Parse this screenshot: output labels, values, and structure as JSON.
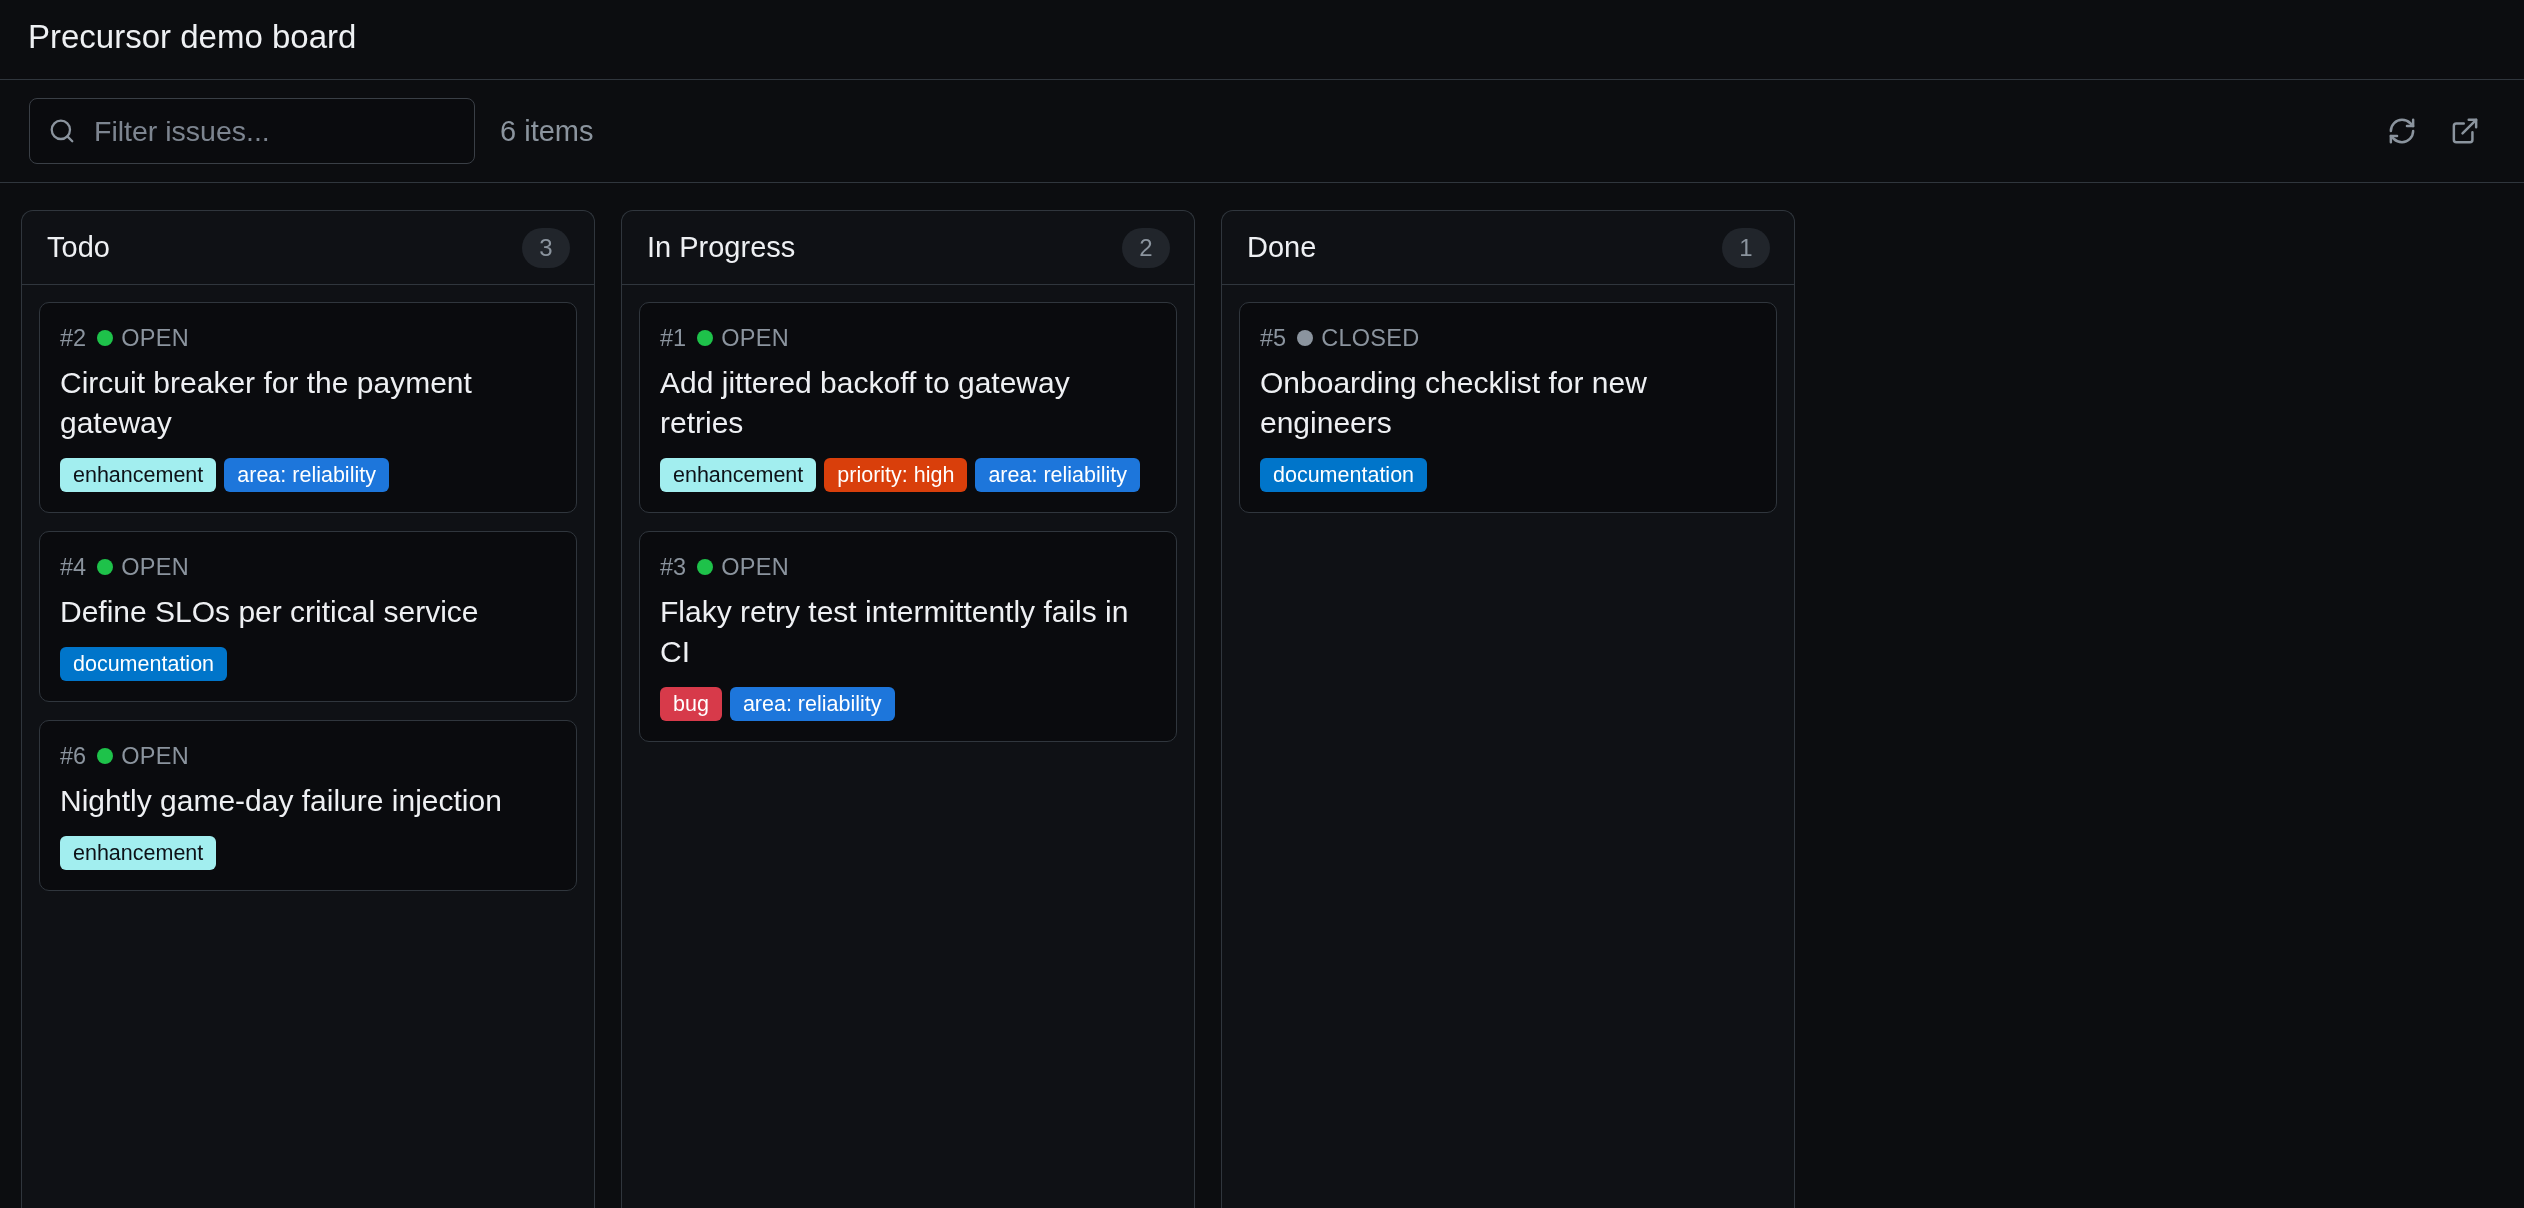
{
  "header": {
    "title": "Precursor demo board"
  },
  "toolbar": {
    "search": {
      "placeholder": "Filter issues..."
    },
    "item_count": "6 items"
  },
  "columns": [
    {
      "title": "Todo",
      "count": "3",
      "cards": [
        {
          "number": "#2",
          "closed": false,
          "state_label": "OPEN",
          "title": "Circuit breaker for the payment gateway",
          "labels": [
            {
              "name": "enhancement",
              "color": "#a2eeef"
            },
            {
              "name": "area: reliability",
              "color": "#1d76db"
            }
          ]
        },
        {
          "number": "#4",
          "closed": false,
          "state_label": "OPEN",
          "title": "Define SLOs per critical service",
          "labels": [
            {
              "name": "documentation",
              "color": "#0075ca"
            }
          ]
        },
        {
          "number": "#6",
          "closed": false,
          "state_label": "OPEN",
          "title": "Nightly game-day failure injection",
          "labels": [
            {
              "name": "enhancement",
              "color": "#a2eeef"
            }
          ]
        }
      ]
    },
    {
      "title": "In Progress",
      "count": "2",
      "cards": [
        {
          "number": "#1",
          "closed": false,
          "state_label": "OPEN",
          "title": "Add jittered backoff to gateway retries",
          "labels": [
            {
              "name": "enhancement",
              "color": "#a2eeef"
            },
            {
              "name": "priority: high",
              "color": "#d93f0b"
            },
            {
              "name": "area: reliability",
              "color": "#1d76db"
            }
          ]
        },
        {
          "number": "#3",
          "closed": false,
          "state_label": "OPEN",
          "title": "Flaky retry test intermittently fails in CI",
          "labels": [
            {
              "name": "bug",
              "color": "#d73a4a"
            },
            {
              "name": "area: reliability",
              "color": "#1d76db"
            }
          ]
        }
      ]
    },
    {
      "title": "Done",
      "count": "1",
      "cards": [
        {
          "number": "#5",
          "closed": true,
          "state_label": "CLOSED",
          "title": "Onboarding checklist for new engineers",
          "labels": [
            {
              "name": "documentation",
              "color": "#0075ca"
            }
          ]
        }
      ]
    }
  ]
}
